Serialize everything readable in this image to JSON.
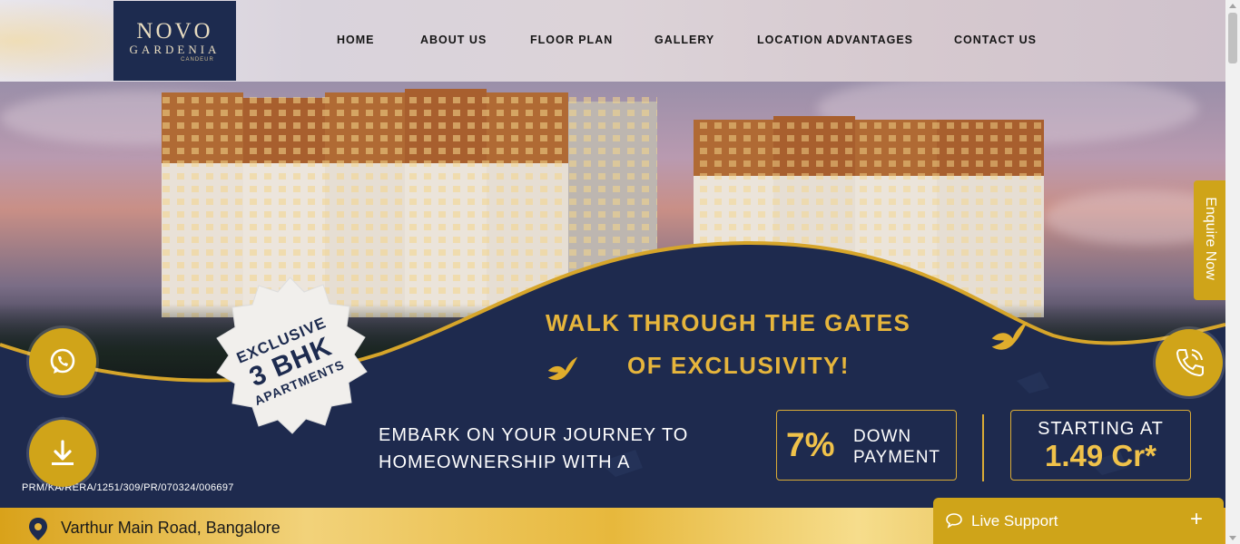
{
  "brand": {
    "logo_main": "NOVO",
    "logo_sub": "GARDENIA",
    "logo_tag": "CANDEUR"
  },
  "nav": {
    "items": [
      {
        "label": "HOME"
      },
      {
        "label": "ABOUT US"
      },
      {
        "label": "FLOOR PLAN"
      },
      {
        "label": "GALLERY"
      },
      {
        "label": "LOCATION ADVANTAGES"
      },
      {
        "label": "CONTACT US"
      }
    ]
  },
  "hero": {
    "headline_line1": "WALK THROUGH THE GATES",
    "headline_line2": "OF EXCLUSIVITY!",
    "badge": {
      "line1": "EXCLUSIVE",
      "line2": "3 BHK",
      "line3": "APARTMENTS"
    },
    "journey_line1": "EMBARK ON YOUR JOURNEY TO",
    "journey_line2": "HOMEOWNERSHIP WITH A",
    "down_payment": {
      "percent": "7%",
      "label_line1": "DOWN",
      "label_line2": "PAYMENT"
    },
    "starting": {
      "label": "STARTING AT",
      "price": "1.49 Cr*"
    },
    "rera": "PRM/KA/RERA/1251/309/PR/070324/006697"
  },
  "location": {
    "text": "Varthur Main Road, Bangalore"
  },
  "side": {
    "enquire_label": "Enquire Now"
  },
  "live_support": {
    "label": "Live Support",
    "plus": "+"
  },
  "icons": {
    "whatsapp": "whatsapp-icon",
    "download": "download-icon",
    "phone": "phone-icon",
    "map_pin": "map-pin-icon",
    "chat": "chat-icon"
  },
  "colors": {
    "navy": "#1d2b4f",
    "gold": "#d0a419",
    "gold_text": "#e6b53c"
  }
}
